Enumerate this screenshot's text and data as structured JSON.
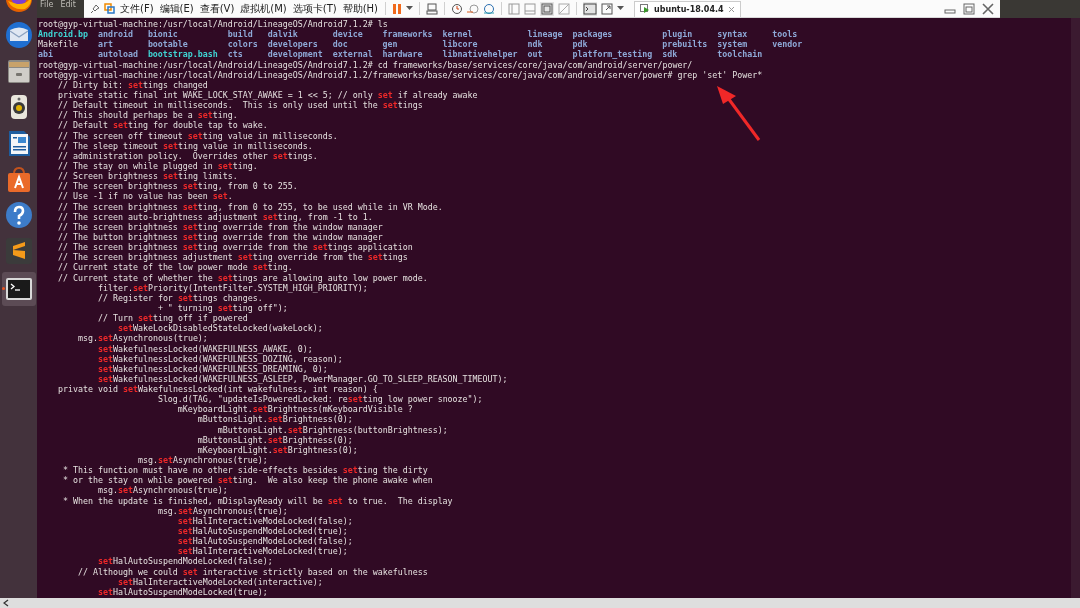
{
  "dock": {
    "items": [
      {
        "selected": false,
        "running": false
      },
      {
        "selected": false,
        "running": false
      },
      {
        "selected": false,
        "running": false
      },
      {
        "selected": false,
        "running": false
      },
      {
        "selected": false,
        "running": false
      },
      {
        "selected": false,
        "running": false
      },
      {
        "selected": false,
        "running": false
      },
      {
        "selected": false,
        "running": false
      },
      {
        "selected": true,
        "running": true
      }
    ]
  },
  "terminal": {
    "menu": [
      "File",
      "Edit"
    ],
    "lines": [
      {
        "kind": "prompt",
        "prompt": "root@gyp-virtual-machine:/usr/local/Android/LineageOS/Android7.1.2#",
        "command": " ls"
      },
      {
        "kind": "ls_row",
        "entries": [
          {
            "name": "Android.bp",
            "kind": "link"
          },
          {
            "name": "android",
            "kind": "dir"
          },
          {
            "name": "bionic",
            "kind": "dir"
          },
          {
            "name": "build",
            "kind": "dir"
          },
          {
            "name": "dalvik",
            "kind": "dir"
          },
          {
            "name": "device",
            "kind": "dir"
          },
          {
            "name": "frameworks",
            "kind": "dir"
          },
          {
            "name": "kernel",
            "kind": "dir"
          },
          {
            "name": "lineage",
            "kind": "dir"
          },
          {
            "name": "packages",
            "kind": "dir"
          },
          {
            "name": "plugin",
            "kind": "dir"
          },
          {
            "name": "syntax",
            "kind": "dir"
          },
          {
            "name": "tools",
            "kind": "dir"
          }
        ]
      },
      {
        "kind": "ls_row",
        "entries": [
          {
            "name": "Makefile",
            "kind": "file"
          },
          {
            "name": "art",
            "kind": "dir"
          },
          {
            "name": "bootable",
            "kind": "dir"
          },
          {
            "name": "colors",
            "kind": "dir"
          },
          {
            "name": "developers",
            "kind": "dir"
          },
          {
            "name": "doc",
            "kind": "dir"
          },
          {
            "name": "gen",
            "kind": "dir"
          },
          {
            "name": "libcore",
            "kind": "dir"
          },
          {
            "name": "ndk",
            "kind": "dir"
          },
          {
            "name": "pdk",
            "kind": "dir"
          },
          {
            "name": "prebuilts",
            "kind": "dir"
          },
          {
            "name": "system",
            "kind": "dir"
          },
          {
            "name": "vendor",
            "kind": "dir"
          }
        ]
      },
      {
        "kind": "ls_row",
        "entries": [
          {
            "name": "abi",
            "kind": "dir"
          },
          {
            "name": "autoload",
            "kind": "dir"
          },
          {
            "name": "bootstrap.bash",
            "kind": "link"
          },
          {
            "name": "cts",
            "kind": "dir"
          },
          {
            "name": "development",
            "kind": "dir"
          },
          {
            "name": "external",
            "kind": "dir"
          },
          {
            "name": "hardware",
            "kind": "dir"
          },
          {
            "name": "libnativehelper",
            "kind": "dir"
          },
          {
            "name": "out",
            "kind": "dir"
          },
          {
            "name": "platform_testing",
            "kind": "dir"
          },
          {
            "name": "sdk",
            "kind": "dir"
          },
          {
            "name": "toolchain",
            "kind": "dir"
          }
        ]
      },
      {
        "kind": "prompt",
        "prompt": "root@gyp-virtual-machine:/usr/local/Android/LineageOS/Android7.1.2#",
        "command": " cd frameworks/base/services/core/java/com/android/server/power/"
      },
      {
        "kind": "prompt",
        "prompt": "root@gyp-virtual-machine:/usr/local/Android/LineageOS/Android7.1.2/frameworks/base/services/core/java/com/android/server/power#",
        "command": " grep 'set' Power*"
      },
      {
        "kind": "match",
        "segments": [
          {
            "text": "    // Dirty bit: ",
            "match": false
          },
          {
            "text": "set",
            "match": true
          },
          {
            "text": "tings changed",
            "match": false
          }
        ]
      },
      {
        "kind": "match",
        "segments": [
          {
            "text": "    private static final int WAKE_LOCK_STAY_AWAKE = 1 << 5; // only ",
            "match": false
          },
          {
            "text": "set",
            "match": true
          },
          {
            "text": " if already awake",
            "match": false
          }
        ]
      },
      {
        "kind": "match",
        "segments": [
          {
            "text": "    // Default timeout in milliseconds.  This is only used until the ",
            "match": false
          },
          {
            "text": "set",
            "match": true
          },
          {
            "text": "tings",
            "match": false
          }
        ]
      },
      {
        "kind": "match",
        "segments": [
          {
            "text": "    // This should perhaps be a ",
            "match": false
          },
          {
            "text": "set",
            "match": true
          },
          {
            "text": "ting.",
            "match": false
          }
        ]
      },
      {
        "kind": "match",
        "segments": [
          {
            "text": "    // Default ",
            "match": false
          },
          {
            "text": "set",
            "match": true
          },
          {
            "text": "ting for double tap to wake.",
            "match": false
          }
        ]
      },
      {
        "kind": "match",
        "segments": [
          {
            "text": "    // The screen off timeout ",
            "match": false
          },
          {
            "text": "set",
            "match": true
          },
          {
            "text": "ting value in milliseconds.",
            "match": false
          }
        ]
      },
      {
        "kind": "match",
        "segments": [
          {
            "text": "    // The sleep timeout ",
            "match": false
          },
          {
            "text": "set",
            "match": true
          },
          {
            "text": "ting value in milliseconds.",
            "match": false
          }
        ]
      },
      {
        "kind": "match",
        "segments": [
          {
            "text": "    // administration policy.  Overrides other ",
            "match": false
          },
          {
            "text": "set",
            "match": true
          },
          {
            "text": "tings.",
            "match": false
          }
        ]
      },
      {
        "kind": "match",
        "segments": [
          {
            "text": "    // The stay on while plugged in ",
            "match": false
          },
          {
            "text": "set",
            "match": true
          },
          {
            "text": "ting.",
            "match": false
          }
        ]
      },
      {
        "kind": "match",
        "segments": [
          {
            "text": "    // Screen brightness ",
            "match": false
          },
          {
            "text": "set",
            "match": true
          },
          {
            "text": "ting limits.",
            "match": false
          }
        ]
      },
      {
        "kind": "match",
        "segments": [
          {
            "text": "    // The screen brightness ",
            "match": false
          },
          {
            "text": "set",
            "match": true
          },
          {
            "text": "ting, from 0 to 255.",
            "match": false
          }
        ]
      },
      {
        "kind": "match",
        "segments": [
          {
            "text": "    // Use -1 if no value has been ",
            "match": false
          },
          {
            "text": "set",
            "match": true
          },
          {
            "text": ".",
            "match": false
          }
        ]
      },
      {
        "kind": "match",
        "segments": [
          {
            "text": "    // The screen brightness ",
            "match": false
          },
          {
            "text": "set",
            "match": true
          },
          {
            "text": "ting, from 0 to 255, to be used while in VR Mode.",
            "match": false
          }
        ]
      },
      {
        "kind": "match",
        "segments": [
          {
            "text": "    // The screen auto-brightness adjustment ",
            "match": false
          },
          {
            "text": "set",
            "match": true
          },
          {
            "text": "ting, from -1 to 1.",
            "match": false
          }
        ]
      },
      {
        "kind": "match",
        "segments": [
          {
            "text": "    // The screen brightness ",
            "match": false
          },
          {
            "text": "set",
            "match": true
          },
          {
            "text": "ting override from the window manager",
            "match": false
          }
        ]
      },
      {
        "kind": "match",
        "segments": [
          {
            "text": "    // The button brightness ",
            "match": false
          },
          {
            "text": "set",
            "match": true
          },
          {
            "text": "ting override from the window manager",
            "match": false
          }
        ]
      },
      {
        "kind": "match",
        "segments": [
          {
            "text": "    // The screen brightness ",
            "match": false
          },
          {
            "text": "set",
            "match": true
          },
          {
            "text": "ting override from the ",
            "match": false
          },
          {
            "text": "set",
            "match": true
          },
          {
            "text": "tings application",
            "match": false
          }
        ]
      },
      {
        "kind": "match",
        "segments": [
          {
            "text": "    // The screen brightness adjustment ",
            "match": false
          },
          {
            "text": "set",
            "match": true
          },
          {
            "text": "ting override from the ",
            "match": false
          },
          {
            "text": "set",
            "match": true
          },
          {
            "text": "tings",
            "match": false
          }
        ]
      },
      {
        "kind": "match",
        "segments": [
          {
            "text": "    // Current state of the low power mode ",
            "match": false
          },
          {
            "text": "set",
            "match": true
          },
          {
            "text": "ting.",
            "match": false
          }
        ]
      },
      {
        "kind": "match",
        "segments": [
          {
            "text": "    // Current state of whether the ",
            "match": false
          },
          {
            "text": "set",
            "match": true
          },
          {
            "text": "tings are allowing auto low power mode.",
            "match": false
          }
        ]
      },
      {
        "kind": "match",
        "segments": [
          {
            "text": "            filter.",
            "match": false
          },
          {
            "text": "set",
            "match": true
          },
          {
            "text": "Priority(IntentFilter.SYSTEM_HIGH_PRIORITY);",
            "match": false
          }
        ]
      },
      {
        "kind": "match",
        "segments": [
          {
            "text": "            // Register for ",
            "match": false
          },
          {
            "text": "set",
            "match": true
          },
          {
            "text": "tings changes.",
            "match": false
          }
        ]
      },
      {
        "kind": "match",
        "segments": [
          {
            "text": "                        + \" turning ",
            "match": false
          },
          {
            "text": "set",
            "match": true
          },
          {
            "text": "ting off\");",
            "match": false
          }
        ]
      },
      {
        "kind": "match",
        "segments": [
          {
            "text": "            // Turn ",
            "match": false
          },
          {
            "text": "set",
            "match": true
          },
          {
            "text": "ting off if powered",
            "match": false
          }
        ]
      },
      {
        "kind": "match",
        "segments": [
          {
            "text": "                set",
            "match": true
          },
          {
            "text": "WakeLockDisabledStateLocked(wakeLock);",
            "match": false
          }
        ]
      },
      {
        "kind": "match",
        "segments": [
          {
            "text": "        msg.",
            "match": false
          },
          {
            "text": "set",
            "match": true
          },
          {
            "text": "Asynchronous(true);",
            "match": false
          }
        ]
      },
      {
        "kind": "match",
        "segments": [
          {
            "text": "            set",
            "match": true
          },
          {
            "text": "WakefulnessLocked(WAKEFULNESS_AWAKE, 0);",
            "match": false
          }
        ]
      },
      {
        "kind": "match",
        "segments": [
          {
            "text": "            set",
            "match": true
          },
          {
            "text": "WakefulnessLocked(WAKEFULNESS_DOZING, reason);",
            "match": false
          }
        ]
      },
      {
        "kind": "match",
        "segments": [
          {
            "text": "            set",
            "match": true
          },
          {
            "text": "WakefulnessLocked(WAKEFULNESS_DREAMING, 0);",
            "match": false
          }
        ]
      },
      {
        "kind": "match",
        "segments": [
          {
            "text": "            set",
            "match": true
          },
          {
            "text": "WakefulnessLocked(WAKEFULNESS_ASLEEP, PowerManager.GO_TO_SLEEP_REASON_TIMEOUT);",
            "match": false
          }
        ]
      },
      {
        "kind": "match",
        "segments": [
          {
            "text": "    private void ",
            "match": false
          },
          {
            "text": "set",
            "match": true
          },
          {
            "text": "WakefulnessLocked(int wakefulness, int reason) {",
            "match": false
          }
        ]
      },
      {
        "kind": "match",
        "segments": [
          {
            "text": "                        Slog.d(TAG, \"updateIsPoweredLocked: re",
            "match": false
          },
          {
            "text": "set",
            "match": true
          },
          {
            "text": "ting low power snooze\");",
            "match": false
          }
        ]
      },
      {
        "kind": "match",
        "segments": [
          {
            "text": "                            mKeyboardLight.",
            "match": false
          },
          {
            "text": "set",
            "match": true
          },
          {
            "text": "Brightness(mKeyboardVisible ?",
            "match": false
          }
        ]
      },
      {
        "kind": "match",
        "segments": [
          {
            "text": "                                mButtonsLight.",
            "match": false
          },
          {
            "text": "set",
            "match": true
          },
          {
            "text": "Brightness(0);",
            "match": false
          }
        ]
      },
      {
        "kind": "match",
        "segments": [
          {
            "text": "                                    mButtonsLight.",
            "match": false
          },
          {
            "text": "set",
            "match": true
          },
          {
            "text": "Brightness(buttonBrightness);",
            "match": false
          }
        ]
      },
      {
        "kind": "match",
        "segments": [
          {
            "text": "                                mButtonsLight.",
            "match": false
          },
          {
            "text": "set",
            "match": true
          },
          {
            "text": "Brightness(0);",
            "match": false
          }
        ]
      },
      {
        "kind": "match",
        "segments": [
          {
            "text": "                                mKeyboardLight.",
            "match": false
          },
          {
            "text": "set",
            "match": true
          },
          {
            "text": "Brightness(0);",
            "match": false
          }
        ]
      },
      {
        "kind": "match",
        "segments": [
          {
            "text": "                    msg.",
            "match": false
          },
          {
            "text": "set",
            "match": true
          },
          {
            "text": "Asynchronous(true);",
            "match": false
          }
        ]
      },
      {
        "kind": "match",
        "segments": [
          {
            "text": "     * This function must have no other side-effects besides ",
            "match": false
          },
          {
            "text": "set",
            "match": true
          },
          {
            "text": "ting the dirty",
            "match": false
          }
        ]
      },
      {
        "kind": "match",
        "segments": [
          {
            "text": "     * or the stay on while powered ",
            "match": false
          },
          {
            "text": "set",
            "match": true
          },
          {
            "text": "ting.  We also keep the phone awake when",
            "match": false
          }
        ]
      },
      {
        "kind": "match",
        "segments": [
          {
            "text": "            msg.",
            "match": false
          },
          {
            "text": "set",
            "match": true
          },
          {
            "text": "Asynchronous(true);",
            "match": false
          }
        ]
      },
      {
        "kind": "match",
        "segments": [
          {
            "text": "     * When the update is finished, mDisplayReady will be ",
            "match": false
          },
          {
            "text": "set",
            "match": true
          },
          {
            "text": " to true.  The display",
            "match": false
          }
        ]
      },
      {
        "kind": "match",
        "segments": [
          {
            "text": "                        msg.",
            "match": false
          },
          {
            "text": "set",
            "match": true
          },
          {
            "text": "Asynchronous(true);",
            "match": false
          }
        ]
      },
      {
        "kind": "match",
        "segments": [
          {
            "text": "                            set",
            "match": true
          },
          {
            "text": "HalInteractiveModeLocked(false);",
            "match": false
          }
        ]
      },
      {
        "kind": "match",
        "segments": [
          {
            "text": "                            set",
            "match": true
          },
          {
            "text": "HalAutoSuspendModeLocked(true);",
            "match": false
          }
        ]
      },
      {
        "kind": "match",
        "segments": [
          {
            "text": "                            set",
            "match": true
          },
          {
            "text": "HalAutoSuspendModeLocked(false);",
            "match": false
          }
        ]
      },
      {
        "kind": "match",
        "segments": [
          {
            "text": "                            set",
            "match": true
          },
          {
            "text": "HalInteractiveModeLocked(true);",
            "match": false
          }
        ]
      },
      {
        "kind": "match",
        "segments": [
          {
            "text": "            set",
            "match": true
          },
          {
            "text": "HalAutoSuspendModeLocked(false);",
            "match": false
          }
        ]
      },
      {
        "kind": "match",
        "segments": [
          {
            "text": "        // Although we could ",
            "match": false
          },
          {
            "text": "set",
            "match": true
          },
          {
            "text": " interactive strictly based on the wakefulness",
            "match": false
          }
        ]
      },
      {
        "kind": "match",
        "segments": [
          {
            "text": "                set",
            "match": true
          },
          {
            "text": "HalInteractiveModeLocked(interactive);",
            "match": false
          }
        ]
      },
      {
        "kind": "match",
        "segments": [
          {
            "text": "            set",
            "match": true
          },
          {
            "text": "HalAutoSuspendModeLocked(true);",
            "match": false
          }
        ]
      }
    ]
  },
  "vm_toolbar": {
    "menus": [
      "文件(F)",
      "编辑(E)",
      "查看(V)",
      "虚拟机(M)",
      "选项卡(T)",
      "帮助(H)"
    ],
    "tabs": [
      {
        "label": "ubuntu-18.04.4",
        "selected": true
      }
    ]
  }
}
